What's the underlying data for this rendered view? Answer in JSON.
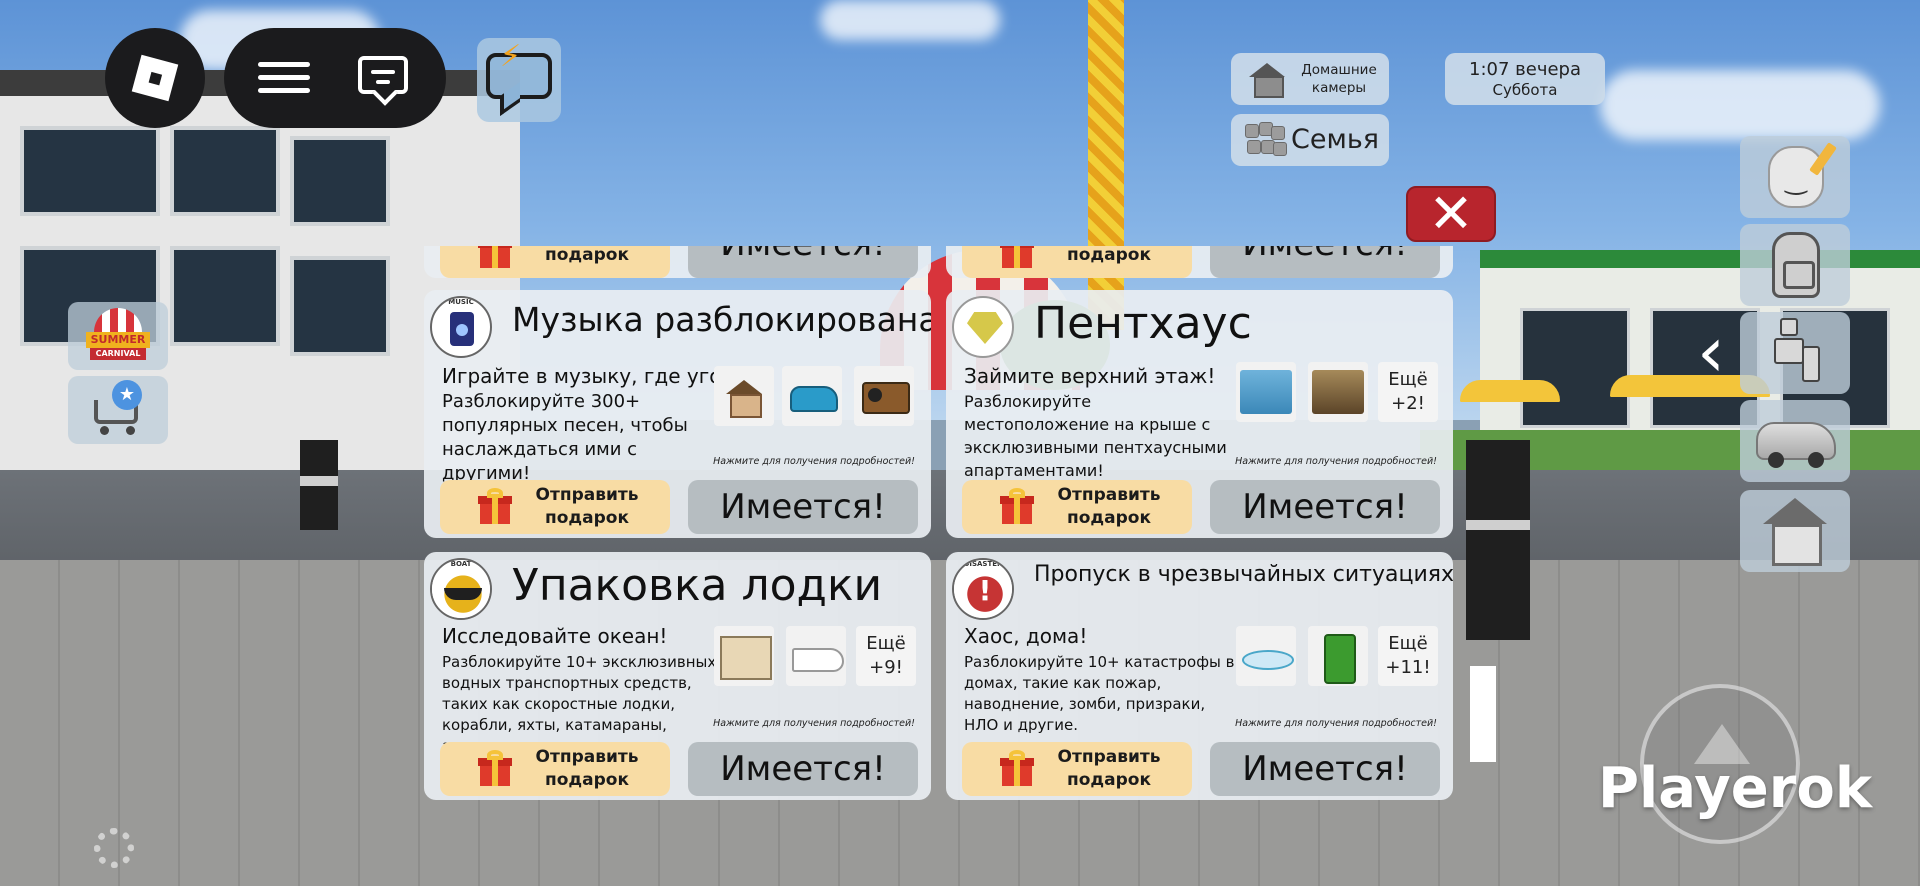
{
  "hud": {
    "home_cameras": "Домашние камеры",
    "family": "Семья",
    "time": "1:07 вечера",
    "day": "Суббота"
  },
  "left_buttons": {
    "carnival_word": "SUMMER",
    "carnival_sub": "CARNIVAL"
  },
  "cards": [
    {
      "title": "Музыка разблокирована",
      "emblem_label": "MUSIC",
      "subtitle": "Играйте в музыку, где угодно!",
      "description": "Разблокируйте 300+ популярных песен, чтобы наслаждаться ими с другими!",
      "hint": "Нажмите для получения подробностей!",
      "gift_label": "Отправить подарок",
      "owned_label": "Имеется!"
    },
    {
      "title": "Пентхаус",
      "subtitle": "Займите верхний этаж!",
      "description": "Разблокируйте местоположение на крыше с эксклюзивными пентхаусными апартаментами!",
      "more": "Ещё +2!",
      "hint": "Нажмите для получения подробностей!",
      "gift_label": "Отправить подарок",
      "owned_label": "Имеется!"
    },
    {
      "title": "Упаковка лодки",
      "emblem_label": "BOAT",
      "subtitle": "Исследовайте океан!",
      "description": "Разблокируйте 10+ эксклюзивных водных транспортных средств, таких как скоростные лодки, корабли, яхты, катамараны, акулы и другие.",
      "more": "Ещё +9!",
      "hint": "Нажмите для получения подробностей!",
      "gift_label": "Отправить подарок",
      "owned_label": "Имеется!"
    },
    {
      "title": "Пропуск в чрезвычайных ситуациях",
      "emblem_label": "DISASTER",
      "subtitle": "Хаос, дома!",
      "description": "Разблокируйте 10+ катастрофы в домах, такие как пожар, наводнение, зомби, призраки, НЛО и другие.",
      "more": "Ещё +11!",
      "hint": "Нажмите для получения подробностей!",
      "gift_label": "Отправить подарок",
      "owned_label": "Имеется!"
    }
  ],
  "partial_row": {
    "gift_label": "подарок",
    "owned_label": "Имеется!"
  },
  "watermark": "Playerok",
  "colors": {
    "close": "#b8252d",
    "gift_button": "#f8dca4",
    "owned_button": "#b6bdc1",
    "hud_dark": "#1b1b1d"
  }
}
